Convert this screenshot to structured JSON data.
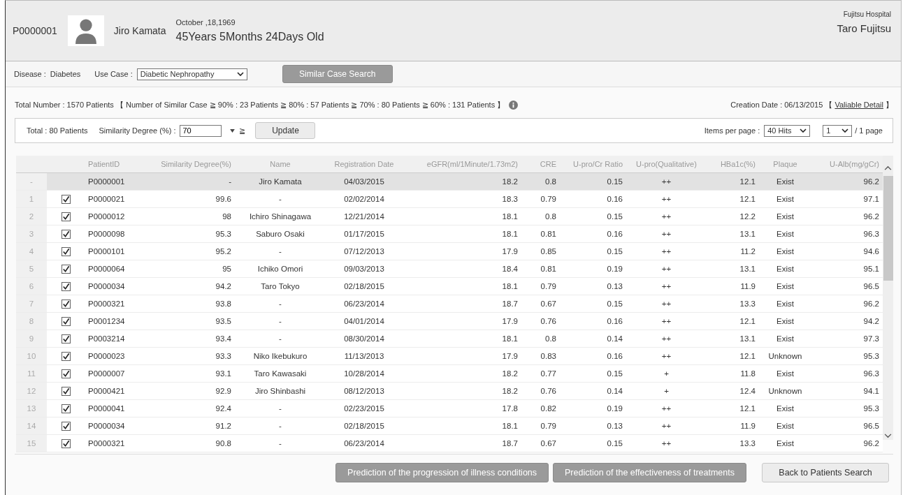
{
  "patient": {
    "id": "P0000001",
    "name": "Jiro Kamata",
    "birth_date": "October ,18,1969",
    "age": "45Years 5Months 24Days Old"
  },
  "hospital": {
    "name": "Fujitsu Hospital",
    "doctor": "Taro Fujitsu"
  },
  "search_bar": {
    "disease_label": "Disease :",
    "disease": "Diabetes",
    "use_case_label": "Use Case :",
    "use_case": "Diabetic Nephropathy",
    "button": "Similar Case Search"
  },
  "summary": {
    "text": "Total Number : 1570 Patients 【 Number of Similar Case  ≧ 90% : 23 Patients   ≧ 80% : 57 Patients   ≧ 70% : 80 Patients   ≧ 60% : 131 Patients 】",
    "creation_date": "Creation Date : 06/13/2015 【",
    "detail_link": "Valiable Detail",
    "bracket_close": "】"
  },
  "filter_bar": {
    "total": "Total : 80 Patients",
    "similarity_label": "Similarity Degree (%) :",
    "similarity_value": "70",
    "operator": "≧",
    "update_button": "Update",
    "items_label": "Items per page :",
    "items_value": "40 Hits",
    "page_value": "1",
    "page_total": "/ 1 page"
  },
  "table": {
    "columns": [
      "PatientID",
      "Similarity Degree(%)",
      "Name",
      "Registration Date",
      "eGFR(ml/1Minute/1.73m2)",
      "CRE",
      "U-pro/Cr Ratio",
      "U-pro(Qualitative)",
      "HBa1c(%)",
      "Plaque",
      "U-Alb(mg/gCr)"
    ],
    "rows": [
      {
        "kind": "reference",
        "no": "-",
        "cells": [
          "P0000001",
          "-",
          "Jiro Kamata",
          "04/03/2015",
          "18.2",
          "0.8",
          "0.15",
          "++",
          "12.1",
          "Exist",
          "96.2"
        ]
      },
      {
        "kind": "result",
        "no": "1",
        "checked": true,
        "cells": [
          "P0000021",
          "99.6",
          "-",
          "02/02/2014",
          "18.3",
          "0.79",
          "0.16",
          "++",
          "12.1",
          "Exist",
          "97.1"
        ]
      },
      {
        "kind": "result",
        "no": "2",
        "checked": true,
        "cells": [
          "P0000012",
          "98",
          "Ichiro Shinagawa",
          "12/21/2014",
          "18.1",
          "0.8",
          "0.15",
          "++",
          "12.2",
          "Exist",
          "96.2"
        ]
      },
      {
        "kind": "result",
        "no": "3",
        "checked": true,
        "cells": [
          "P0000098",
          "95.3",
          "Saburo Osaki",
          "01/17/2015",
          "18.1",
          "0.81",
          "0.16",
          "++",
          "13.1",
          "Exist",
          "96.3"
        ]
      },
      {
        "kind": "result",
        "no": "4",
        "checked": true,
        "cells": [
          "P0000101",
          "95.2",
          "-",
          "07/12/2013",
          "17.9",
          "0.85",
          "0.15",
          "++",
          "11.2",
          "Exist",
          "94.6"
        ]
      },
      {
        "kind": "result",
        "no": "5",
        "checked": true,
        "cells": [
          "P0000064",
          "95",
          "Ichiko Omori",
          "09/03/2013",
          "18.4",
          "0.81",
          "0.19",
          "++",
          "13.1",
          "Exist",
          "95.1"
        ]
      },
      {
        "kind": "result",
        "no": "6",
        "checked": true,
        "cells": [
          "P0000034",
          "94.2",
          "Taro Tokyo",
          "02/18/2015",
          "18.1",
          "0.79",
          "0.13",
          "++",
          "11.9",
          "Exist",
          "96.5"
        ]
      },
      {
        "kind": "result",
        "no": "7",
        "checked": true,
        "cells": [
          "P0000321",
          "93.8",
          "-",
          "06/23/2014",
          "18.7",
          "0.67",
          "0.15",
          "++",
          "13.3",
          "Exist",
          "96.2"
        ]
      },
      {
        "kind": "result",
        "no": "8",
        "checked": true,
        "cells": [
          "P0001234",
          "93.5",
          "-",
          "04/01/2014",
          "17.9",
          "0.76",
          "0.16",
          "++",
          "12.1",
          "Exist",
          "94.2"
        ]
      },
      {
        "kind": "result",
        "no": "9",
        "checked": true,
        "cells": [
          "P0003214",
          "93.4",
          "-",
          "08/30/2014",
          "18.1",
          "0.8",
          "0.14",
          "++",
          "13.1",
          "Exist",
          "97.3"
        ]
      },
      {
        "kind": "result",
        "no": "10",
        "checked": true,
        "cells": [
          "P0000023",
          "93.3",
          "Niko Ikebukuro",
          "11/13/2013",
          "17.9",
          "0.83",
          "0.16",
          "++",
          "12.1",
          "Unknown",
          "95.3"
        ]
      },
      {
        "kind": "result",
        "no": "11",
        "checked": true,
        "cells": [
          "P0000007",
          "93.1",
          "Taro Kawasaki",
          "10/28/2014",
          "18.2",
          "0.77",
          "0.15",
          "+",
          "11.8",
          "Exist",
          "96.3"
        ]
      },
      {
        "kind": "result",
        "no": "12",
        "checked": true,
        "cells": [
          "P0000421",
          "92.9",
          "Jiro Shinbashi",
          "08/12/2013",
          "18.2",
          "0.76",
          "0.14",
          "+",
          "12.4",
          "Unknown",
          "94.1"
        ]
      },
      {
        "kind": "result",
        "no": "13",
        "checked": true,
        "cells": [
          "P0000041",
          "92.4",
          "-",
          "02/23/2015",
          "17.8",
          "0.82",
          "0.19",
          "++",
          "12.1",
          "Exist",
          "95.3"
        ]
      },
      {
        "kind": "result",
        "no": "14",
        "checked": true,
        "cells": [
          "P0000034",
          "91.2",
          "-",
          "02/18/2015",
          "18.1",
          "0.79",
          "0.13",
          "++",
          "11.9",
          "Exist",
          "96.5"
        ]
      },
      {
        "kind": "result",
        "no": "15",
        "checked": true,
        "cells": [
          "P0000321",
          "90.8",
          "-",
          "06/23/2014",
          "18.7",
          "0.67",
          "0.15",
          "++",
          "13.3",
          "Exist",
          "96.2"
        ]
      }
    ]
  },
  "footer_buttons": [
    {
      "label": "Prediction of the progression of illness conditions",
      "kind": "primary"
    },
    {
      "label": "Prediction of the effectiveness of treatments",
      "kind": "primary"
    },
    {
      "label": "Back to Patients Search",
      "kind": "secondary"
    }
  ]
}
